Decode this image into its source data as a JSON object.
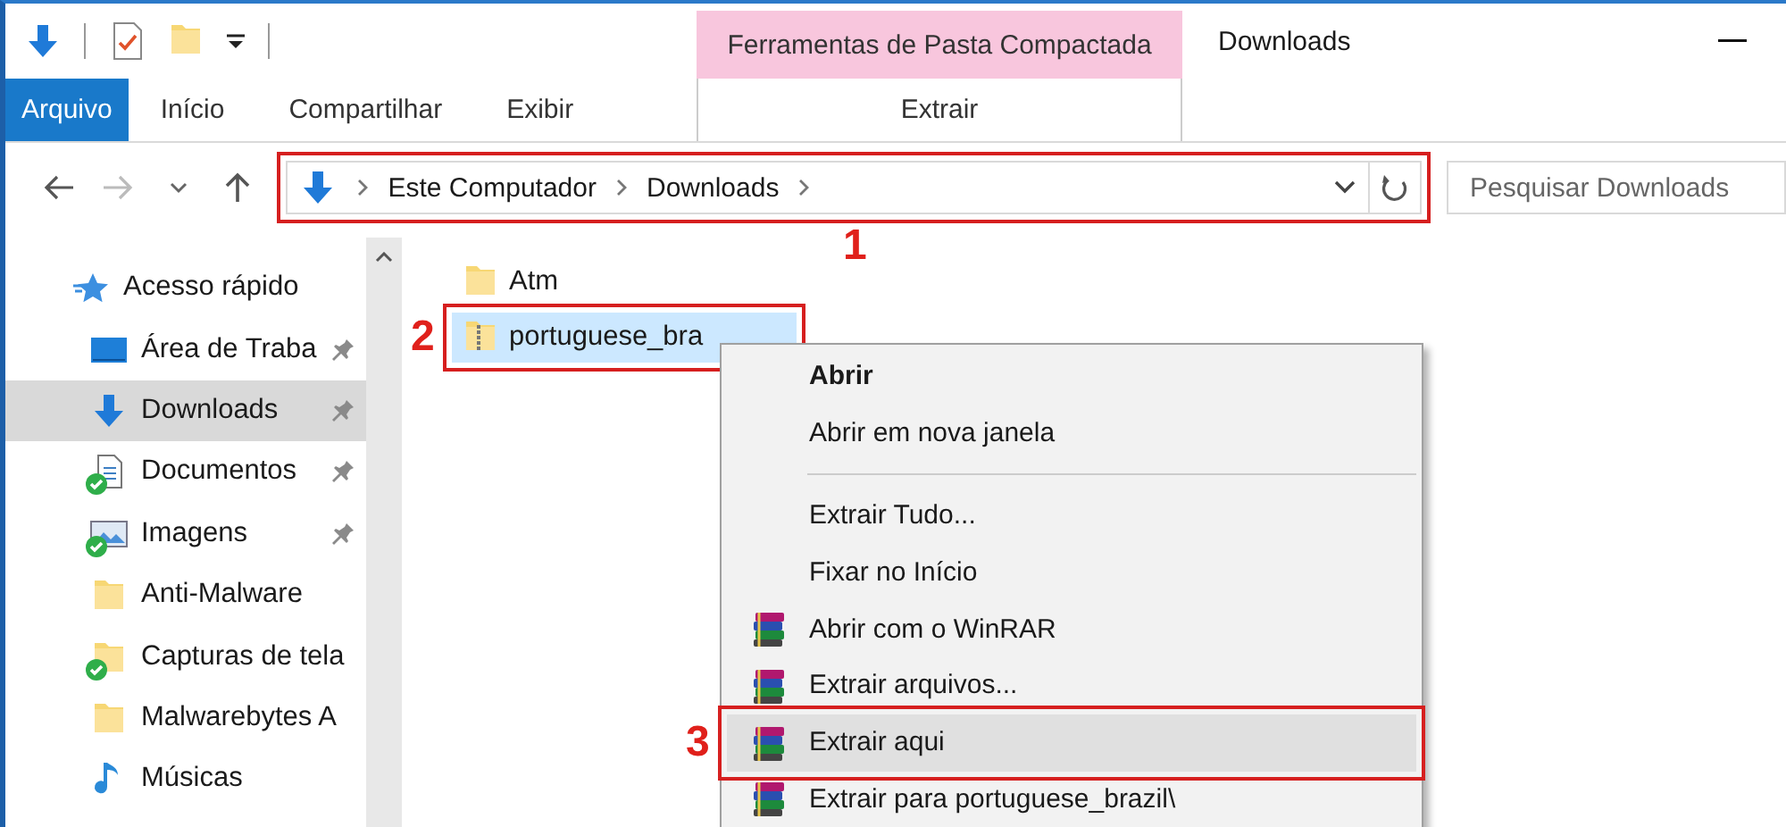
{
  "window": {
    "title": "Downloads"
  },
  "contextual_tabs": {
    "title": "Ferramentas de Pasta Compactada",
    "tabs": [
      {
        "label": "Extrair"
      }
    ]
  },
  "ribbon_tabs": [
    {
      "label": "Arquivo",
      "kind": "file"
    },
    {
      "label": "Início",
      "kind": "tab"
    },
    {
      "label": "Compartilhar",
      "kind": "tab"
    },
    {
      "label": "Exibir",
      "kind": "tab"
    }
  ],
  "address_bar": {
    "breadcrumbs": [
      "Este Computador",
      "Downloads"
    ],
    "annotation": "1"
  },
  "search": {
    "placeholder": "Pesquisar Downloads"
  },
  "navigation": {
    "items": [
      {
        "label": "Acesso rápido",
        "kind": "star",
        "selected": false,
        "children": [
          {
            "label": "Área de Traba",
            "kind": "desktop",
            "pinned": true,
            "synced": false,
            "selected": false
          },
          {
            "label": "Downloads",
            "kind": "download",
            "pinned": true,
            "synced": false,
            "selected": true
          },
          {
            "label": "Documentos",
            "kind": "documents",
            "pinned": true,
            "synced": true,
            "selected": false
          },
          {
            "label": "Imagens",
            "kind": "images",
            "pinned": true,
            "synced": true,
            "selected": false
          },
          {
            "label": "Anti-Malware",
            "kind": "folder",
            "pinned": false,
            "synced": false,
            "selected": false
          },
          {
            "label": "Capturas de tela",
            "kind": "folder",
            "pinned": false,
            "synced": true,
            "selected": false
          },
          {
            "label": "Malwarebytes A",
            "kind": "folder",
            "pinned": false,
            "synced": false,
            "selected": false
          },
          {
            "label": "Músicas",
            "kind": "music",
            "pinned": false,
            "synced": false,
            "selected": false
          }
        ]
      }
    ]
  },
  "files": [
    {
      "name": "Atm",
      "kind": "folder",
      "selected": false
    },
    {
      "name": "portuguese_bra",
      "kind": "zip",
      "selected": true,
      "annotation": "2"
    }
  ],
  "context_menu": {
    "items": [
      {
        "label": "Abrir",
        "kind": "default",
        "selected": false
      },
      {
        "label": "Abrir em nova janela",
        "kind": "item",
        "selected": false
      },
      {
        "kind": "separator"
      },
      {
        "label": "Extrair Tudo...",
        "kind": "item",
        "selected": false
      },
      {
        "label": "Fixar no Início",
        "kind": "item",
        "selected": false
      },
      {
        "label": "Abrir com o WinRAR",
        "kind": "winrar",
        "selected": false
      },
      {
        "label": "Extrair arquivos...",
        "kind": "winrar",
        "selected": false
      },
      {
        "label": "Extrair aqui",
        "kind": "winrar",
        "selected": true,
        "annotation": "3"
      },
      {
        "label": "Extrair para portuguese_brazil\\",
        "kind": "winrar",
        "selected": false
      }
    ]
  }
}
